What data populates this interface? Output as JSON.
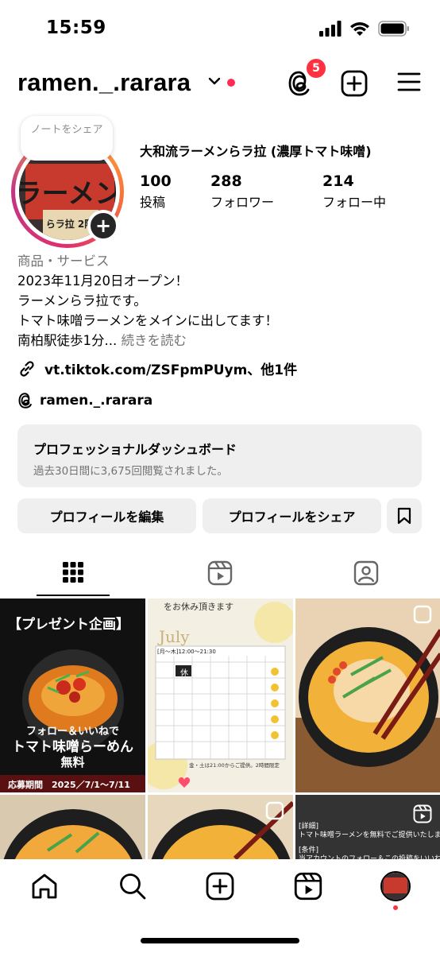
{
  "status": {
    "time": "15:59"
  },
  "header": {
    "username": "ramen._.rarara",
    "threads_badge": "5"
  },
  "note": {
    "text": "ノートをシェア"
  },
  "profile": {
    "display_name": "大和流ラーメンらラ拉 (濃厚トマト味噌)",
    "stats": [
      {
        "value": "100",
        "label": "投稿"
      },
      {
        "value": "288",
        "label": "フォロワー"
      },
      {
        "value": "214",
        "label": "フォロー中"
      }
    ],
    "category": "商品・サービス",
    "bio_lines": [
      "2023年11月20日オープン！",
      "ラーメンらラ拉です。",
      "トマト味噌ラーメンをメインに出してます！",
      "南柏駅徒歩1分..."
    ],
    "bio_more": "続きを読む",
    "link": "vt.tiktok.com/ZSFpmPUym、他1件",
    "threads_handle": "ramen._.rarara",
    "avatar_text": "ラーメン",
    "avatar_sub": "らラ拉 2階"
  },
  "dashboard": {
    "title": "プロフェッショナルダッシュボード",
    "subtitle": "過去30日間に3,675回閲覧されました。"
  },
  "buttons": {
    "edit": "プロフィールを編集",
    "share": "プロフィールをシェア"
  },
  "posts": {
    "p1": {
      "title": "【プレゼント企画】",
      "caption1": "フォロー＆いいねで",
      "caption2": "トマト味噌らーめん",
      "caption3": "無料",
      "period": "応募期間　2025／7/1〜7/11"
    },
    "p2": {
      "top": "をお休み頂きます",
      "month": "July",
      "hours": "[月〜木]12:00〜21:30",
      "rest": "休",
      "footnote": "金・土は21:00からご提供。2時間限定"
    },
    "p6": {
      "line1": "[詳細]",
      "line2": "トマト味噌ラーメンを無料でご提供いたします",
      "line3": "[条件]",
      "line4": "当アカウントのフォロー＆この投稿をいいね"
    }
  },
  "colors": {
    "accent_red": "#ff3040",
    "button_bg": "#efefef",
    "muted": "#737373"
  }
}
